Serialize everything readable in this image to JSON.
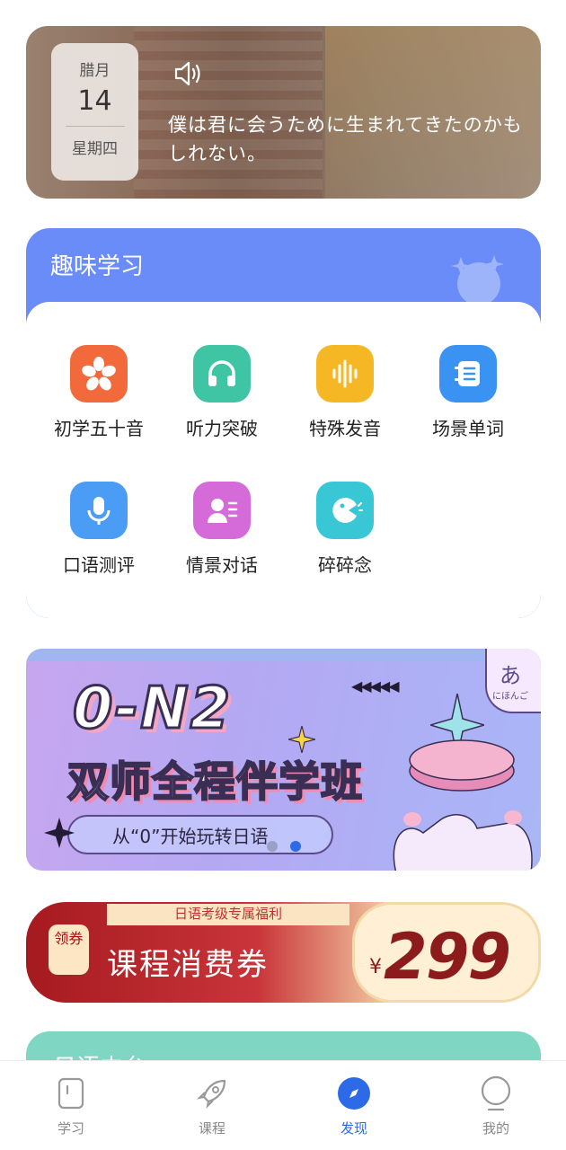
{
  "daily": {
    "month": "腊月",
    "day": "14",
    "weekday": "星期四",
    "quote": "僕は君に会うために生まれてきたのかもしれない。",
    "speaker_icon": "speaker-icon"
  },
  "fun_study": {
    "title": "趣味学习",
    "items": [
      {
        "label": "初学五十音",
        "icon": "sakura-icon",
        "color": "#f26a3c"
      },
      {
        "label": "听力突破",
        "icon": "headphones-icon",
        "color": "#3fc4a4"
      },
      {
        "label": "特殊发音",
        "icon": "soundwave-icon",
        "color": "#f5b724"
      },
      {
        "label": "场景单词",
        "icon": "notebook-icon",
        "color": "#3a93f2"
      },
      {
        "label": "口语测评",
        "icon": "microphone-icon",
        "color": "#4a9cf5"
      },
      {
        "label": "情景对话",
        "icon": "dialogue-icon",
        "color": "#d56ad9"
      },
      {
        "label": "碎碎念",
        "icon": "chatter-icon",
        "color": "#39c7d6"
      }
    ]
  },
  "banner": {
    "title": "0-N2",
    "subtitle": "双师全程伴学班",
    "tagline": "从“0”开始玩转日语",
    "corner_char": "あ",
    "corner_text": "にほんご",
    "arrows": "◀◀◀◀◀"
  },
  "coupon": {
    "top_text": "日语考级专属福利",
    "badge": "领券",
    "title": "课程消费券",
    "currency": "¥",
    "amount": "299"
  },
  "next_card": {
    "title": "日语中台"
  },
  "nav": {
    "items": [
      {
        "label": "学习",
        "icon": "study-icon",
        "active": false
      },
      {
        "label": "课程",
        "icon": "rocket-icon",
        "active": false
      },
      {
        "label": "发现",
        "icon": "compass-icon",
        "active": true
      },
      {
        "label": "我的",
        "icon": "profile-icon",
        "active": false
      }
    ]
  },
  "colors": {
    "accent": "#2d6ae8",
    "fun_header": "#6a8cf8",
    "coupon_red": "#a51a1f",
    "green_card": "#7fd6c2"
  }
}
